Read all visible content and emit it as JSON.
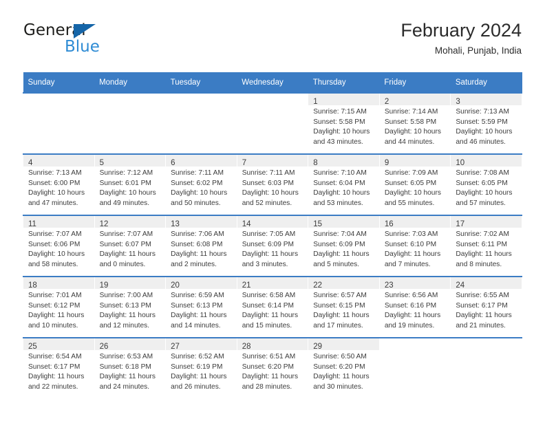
{
  "logo": {
    "line1": "General",
    "line2": "Blue",
    "triangle_color": "#1565a8",
    "line2_color": "#2e8bd4"
  },
  "header": {
    "title": "February 2024",
    "location": "Mohali, Punjab, India"
  },
  "theme": {
    "header_blue": "#3b7cc4",
    "row_divider": "#3b7cc4",
    "daynum_band": "#efefef",
    "text": "#3b3b3b"
  },
  "weekdays": [
    "Sunday",
    "Monday",
    "Tuesday",
    "Wednesday",
    "Thursday",
    "Friday",
    "Saturday"
  ],
  "weeks": [
    [
      {
        "day": "",
        "lines": []
      },
      {
        "day": "",
        "lines": []
      },
      {
        "day": "",
        "lines": []
      },
      {
        "day": "",
        "lines": []
      },
      {
        "day": "1",
        "lines": [
          "Sunrise: 7:15 AM",
          "Sunset: 5:58 PM",
          "Daylight: 10 hours",
          "and 43 minutes."
        ]
      },
      {
        "day": "2",
        "lines": [
          "Sunrise: 7:14 AM",
          "Sunset: 5:58 PM",
          "Daylight: 10 hours",
          "and 44 minutes."
        ]
      },
      {
        "day": "3",
        "lines": [
          "Sunrise: 7:13 AM",
          "Sunset: 5:59 PM",
          "Daylight: 10 hours",
          "and 46 minutes."
        ]
      }
    ],
    [
      {
        "day": "4",
        "lines": [
          "Sunrise: 7:13 AM",
          "Sunset: 6:00 PM",
          "Daylight: 10 hours",
          "and 47 minutes."
        ]
      },
      {
        "day": "5",
        "lines": [
          "Sunrise: 7:12 AM",
          "Sunset: 6:01 PM",
          "Daylight: 10 hours",
          "and 49 minutes."
        ]
      },
      {
        "day": "6",
        "lines": [
          "Sunrise: 7:11 AM",
          "Sunset: 6:02 PM",
          "Daylight: 10 hours",
          "and 50 minutes."
        ]
      },
      {
        "day": "7",
        "lines": [
          "Sunrise: 7:11 AM",
          "Sunset: 6:03 PM",
          "Daylight: 10 hours",
          "and 52 minutes."
        ]
      },
      {
        "day": "8",
        "lines": [
          "Sunrise: 7:10 AM",
          "Sunset: 6:04 PM",
          "Daylight: 10 hours",
          "and 53 minutes."
        ]
      },
      {
        "day": "9",
        "lines": [
          "Sunrise: 7:09 AM",
          "Sunset: 6:05 PM",
          "Daylight: 10 hours",
          "and 55 minutes."
        ]
      },
      {
        "day": "10",
        "lines": [
          "Sunrise: 7:08 AM",
          "Sunset: 6:05 PM",
          "Daylight: 10 hours",
          "and 57 minutes."
        ]
      }
    ],
    [
      {
        "day": "11",
        "lines": [
          "Sunrise: 7:07 AM",
          "Sunset: 6:06 PM",
          "Daylight: 10 hours",
          "and 58 minutes."
        ]
      },
      {
        "day": "12",
        "lines": [
          "Sunrise: 7:07 AM",
          "Sunset: 6:07 PM",
          "Daylight: 11 hours",
          "and 0 minutes."
        ]
      },
      {
        "day": "13",
        "lines": [
          "Sunrise: 7:06 AM",
          "Sunset: 6:08 PM",
          "Daylight: 11 hours",
          "and 2 minutes."
        ]
      },
      {
        "day": "14",
        "lines": [
          "Sunrise: 7:05 AM",
          "Sunset: 6:09 PM",
          "Daylight: 11 hours",
          "and 3 minutes."
        ]
      },
      {
        "day": "15",
        "lines": [
          "Sunrise: 7:04 AM",
          "Sunset: 6:09 PM",
          "Daylight: 11 hours",
          "and 5 minutes."
        ]
      },
      {
        "day": "16",
        "lines": [
          "Sunrise: 7:03 AM",
          "Sunset: 6:10 PM",
          "Daylight: 11 hours",
          "and 7 minutes."
        ]
      },
      {
        "day": "17",
        "lines": [
          "Sunrise: 7:02 AM",
          "Sunset: 6:11 PM",
          "Daylight: 11 hours",
          "and 8 minutes."
        ]
      }
    ],
    [
      {
        "day": "18",
        "lines": [
          "Sunrise: 7:01 AM",
          "Sunset: 6:12 PM",
          "Daylight: 11 hours",
          "and 10 minutes."
        ]
      },
      {
        "day": "19",
        "lines": [
          "Sunrise: 7:00 AM",
          "Sunset: 6:13 PM",
          "Daylight: 11 hours",
          "and 12 minutes."
        ]
      },
      {
        "day": "20",
        "lines": [
          "Sunrise: 6:59 AM",
          "Sunset: 6:13 PM",
          "Daylight: 11 hours",
          "and 14 minutes."
        ]
      },
      {
        "day": "21",
        "lines": [
          "Sunrise: 6:58 AM",
          "Sunset: 6:14 PM",
          "Daylight: 11 hours",
          "and 15 minutes."
        ]
      },
      {
        "day": "22",
        "lines": [
          "Sunrise: 6:57 AM",
          "Sunset: 6:15 PM",
          "Daylight: 11 hours",
          "and 17 minutes."
        ]
      },
      {
        "day": "23",
        "lines": [
          "Sunrise: 6:56 AM",
          "Sunset: 6:16 PM",
          "Daylight: 11 hours",
          "and 19 minutes."
        ]
      },
      {
        "day": "24",
        "lines": [
          "Sunrise: 6:55 AM",
          "Sunset: 6:17 PM",
          "Daylight: 11 hours",
          "and 21 minutes."
        ]
      }
    ],
    [
      {
        "day": "25",
        "lines": [
          "Sunrise: 6:54 AM",
          "Sunset: 6:17 PM",
          "Daylight: 11 hours",
          "and 22 minutes."
        ]
      },
      {
        "day": "26",
        "lines": [
          "Sunrise: 6:53 AM",
          "Sunset: 6:18 PM",
          "Daylight: 11 hours",
          "and 24 minutes."
        ]
      },
      {
        "day": "27",
        "lines": [
          "Sunrise: 6:52 AM",
          "Sunset: 6:19 PM",
          "Daylight: 11 hours",
          "and 26 minutes."
        ]
      },
      {
        "day": "28",
        "lines": [
          "Sunrise: 6:51 AM",
          "Sunset: 6:20 PM",
          "Daylight: 11 hours",
          "and 28 minutes."
        ]
      },
      {
        "day": "29",
        "lines": [
          "Sunrise: 6:50 AM",
          "Sunset: 6:20 PM",
          "Daylight: 11 hours",
          "and 30 minutes."
        ]
      },
      {
        "day": "",
        "lines": []
      },
      {
        "day": "",
        "lines": []
      }
    ]
  ]
}
